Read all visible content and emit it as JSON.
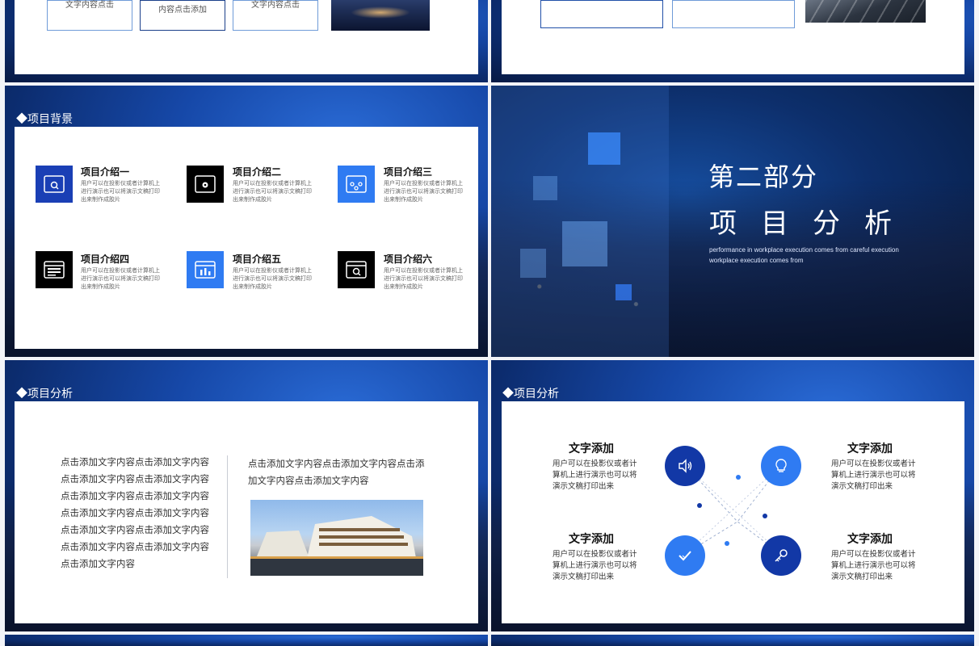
{
  "slide1": {
    "boxes": [
      "文字内容点击",
      "内容点击添加",
      "文字内容点击"
    ]
  },
  "slide3": {
    "heading": "◆项目背景",
    "items": [
      {
        "title": "项目介绍一",
        "desc": "用户可以在投影仪或者计算机上进行演示也可以将演示文稿打印出来制作成胶片",
        "icon": "search-icon",
        "color": "#1a3fb5"
      },
      {
        "title": "项目介绍二",
        "desc": "用户可以在投影仪或者计算机上进行演示也可以将演示文稿打印出来制作成胶片",
        "icon": "settings-icon",
        "color": "#000000"
      },
      {
        "title": "项目介绍三",
        "desc": "用户可以在投影仪或者计算机上进行演示也可以将演示文稿打印出来制作成胶片",
        "icon": "share-icon",
        "color": "#2f7bf2"
      },
      {
        "title": "项目介绍四",
        "desc": "用户可以在投影仪或者计算机上进行演示也可以将演示文稿打印出来制作成胶片",
        "icon": "browser-icon",
        "color": "#000000"
      },
      {
        "title": "项目介绍五",
        "desc": "用户可以在投影仪或者计算机上进行演示也可以将演示文稿打印出来制作成胶片",
        "icon": "chart-icon",
        "color": "#2f7bf2"
      },
      {
        "title": "项目介绍六",
        "desc": "用户可以在投影仪或者计算机上进行演示也可以将演示文稿打印出来制作成胶片",
        "icon": "search-icon",
        "color": "#000000"
      }
    ]
  },
  "slide4": {
    "title_1": "第二部分",
    "title_2": "项目分析",
    "subtitle": "performance in workplace execution comes from careful execution workplace execution comes from"
  },
  "slide5": {
    "heading": "◆项目分析",
    "left_lines": [
      "点击添加文字内容点击添加文字内容",
      "点击添加文字内容点击添加文字内容",
      "点击添加文字内容点击添加文字内容",
      "点击添加文字内容点击添加文字内容",
      "点击添加文字内容点击添加文字内容",
      "点击添加文字内容点击添加文字内容",
      "点击添加文字内容"
    ],
    "right_text": "点击添加文字内容点击添加文字内容点击添加文字内容点击添加文字内容"
  },
  "slide6": {
    "heading": "◆项目分析",
    "blocks": [
      {
        "title": "文字添加",
        "desc": "用户可以在投影仪或者计算机上进行演示也可以将演示文稿打印出来"
      },
      {
        "title": "文字添加",
        "desc": "用户可以在投影仪或者计算机上进行演示也可以将演示文稿打印出来"
      },
      {
        "title": "文字添加",
        "desc": "用户可以在投影仪或者计算机上进行演示也可以将演示文稿打印出来"
      },
      {
        "title": "文字添加",
        "desc": "用户可以在投影仪或者计算机上进行演示也可以将演示文稿打印出来"
      }
    ],
    "icons": [
      "speaker-icon",
      "lightbulb-icon",
      "check-icon",
      "key-icon"
    ],
    "colors": {
      "dark": "#1238a6",
      "light": "#2f7bf2"
    }
  }
}
